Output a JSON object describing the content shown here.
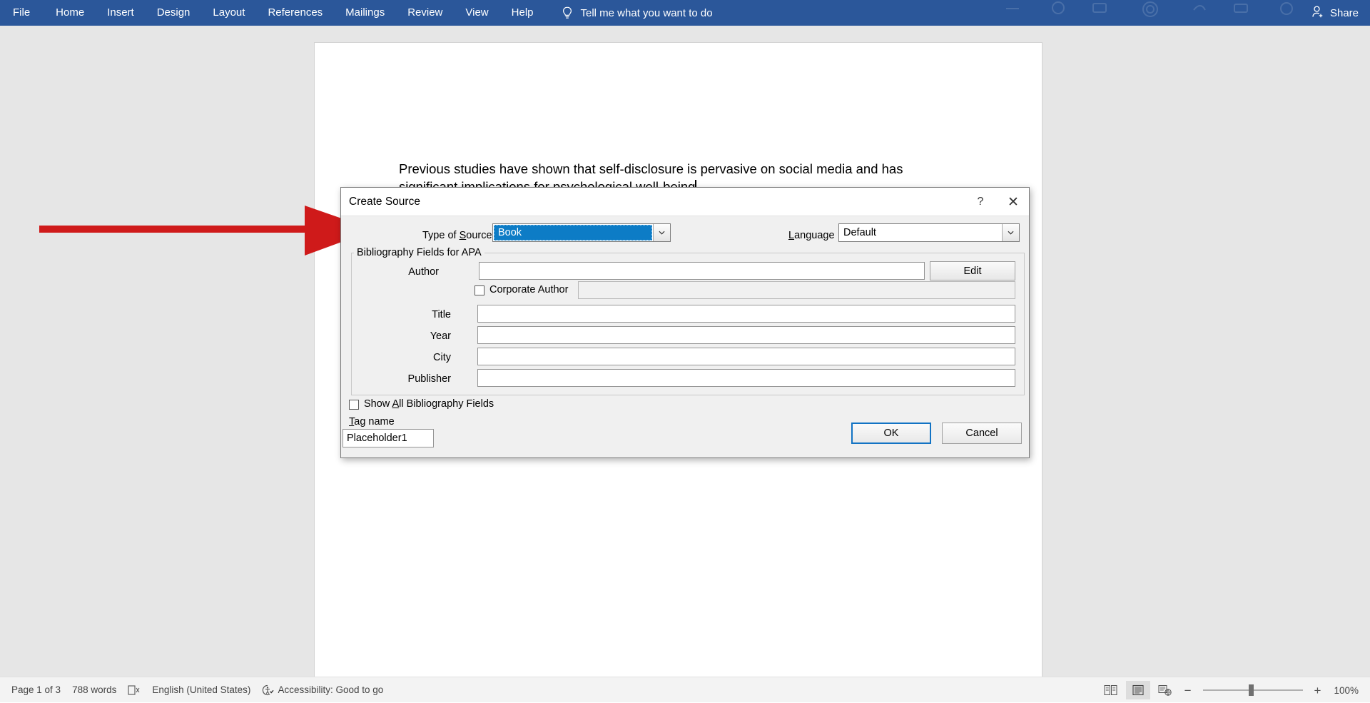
{
  "ribbon": {
    "tabs": [
      {
        "label": "File"
      },
      {
        "label": "Home"
      },
      {
        "label": "Insert"
      },
      {
        "label": "Design"
      },
      {
        "label": "Layout"
      },
      {
        "label": "References"
      },
      {
        "label": "Mailings"
      },
      {
        "label": "Review"
      },
      {
        "label": "View"
      },
      {
        "label": "Help"
      }
    ],
    "tellme": "Tell me what you want to do",
    "tellme_icon": "lightbulb-icon",
    "share": "Share",
    "share_icon": "person-add-icon",
    "accent_color": "#2b579a"
  },
  "document": {
    "paragraph_line1": "Previous studies have shown that self-disclosure is pervasive on social media and has significant",
    "paragraph_line2": "implications for psychological well-being"
  },
  "annotation": {
    "type": "arrow",
    "color": "#cf1a1a",
    "points_to": "Type of Source"
  },
  "dialog": {
    "title": "Create Source",
    "help_icon": "question-mark-icon",
    "close_icon": "close-icon",
    "type_of_source": {
      "label_pre": "Type of ",
      "label_accel": "S",
      "label_post": "ource",
      "value": "Book",
      "selected": true,
      "highlight_color": "#0d7cc6"
    },
    "language": {
      "label_accel": "L",
      "label_post": "anguage",
      "value": "Default"
    },
    "group_legend": "Bibliography Fields for APA",
    "fields": [
      {
        "label": "Author",
        "value": "",
        "disabled": false
      },
      {
        "label": "Title",
        "value": "",
        "disabled": false
      },
      {
        "label": "Year",
        "value": "",
        "disabled": false
      },
      {
        "label": "City",
        "value": "",
        "disabled": false
      },
      {
        "label": "Publisher",
        "value": "",
        "disabled": false
      }
    ],
    "edit_button": "Edit",
    "corporate_author": {
      "label": "Corporate Author",
      "checked": false,
      "value": "",
      "disabled": true
    },
    "show_all": {
      "label_pre": "Show ",
      "label_accel": "A",
      "label_post": "ll Bibliography Fields",
      "checked": false
    },
    "tag_name": {
      "label_accel": "T",
      "label_post": "ag name",
      "value": "Placeholder1"
    },
    "ok_button": "OK",
    "cancel_button": "Cancel",
    "focus_color": "#1273c4"
  },
  "statusbar": {
    "page": "Page 1 of 3",
    "words": "788 words",
    "proofing_icon": "spellcheck-icon",
    "language": "English (United States)",
    "accessibility_icon": "accessibility-icon",
    "accessibility": "Accessibility: Good to go",
    "views": [
      {
        "name": "read-mode",
        "active": false
      },
      {
        "name": "print-layout",
        "active": true
      },
      {
        "name": "web-layout",
        "active": false
      }
    ],
    "zoom_out_icon": "minus-icon",
    "zoom_in_icon": "plus-icon",
    "zoom_level": "100%"
  }
}
